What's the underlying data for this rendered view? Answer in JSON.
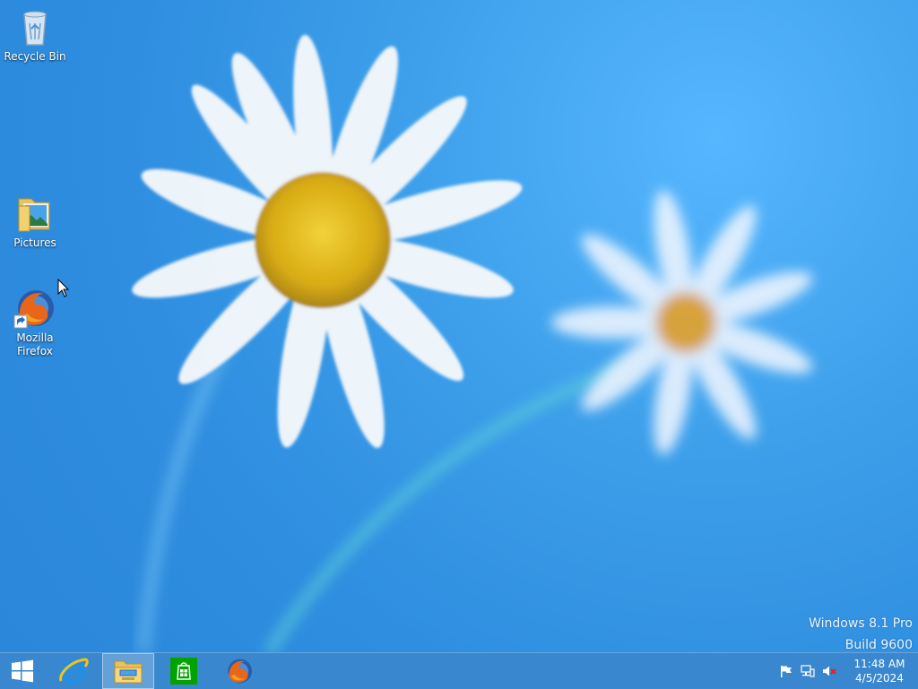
{
  "desktop": {
    "icons": [
      {
        "label": "Recycle Bin",
        "icon": "recycle-bin-icon"
      },
      {
        "label": "Pictures",
        "icon": "pictures-folder-icon"
      },
      {
        "label": "Mozilla Firefox",
        "icon": "firefox-shortcut-icon"
      }
    ],
    "watermark": {
      "line1": "Windows 8.1 Pro",
      "line2": "Build 9600"
    }
  },
  "taskbar": {
    "items": [
      {
        "name": "start",
        "icon": "windows-logo-icon"
      },
      {
        "name": "internet-explorer",
        "icon": "internet-explorer-icon"
      },
      {
        "name": "file-explorer",
        "icon": "file-explorer-icon",
        "active": true
      },
      {
        "name": "store",
        "icon": "store-icon"
      },
      {
        "name": "firefox",
        "icon": "firefox-icon"
      }
    ],
    "tray": {
      "icons": [
        "action-center-flag-icon",
        "network-icon",
        "volume-muted-icon"
      ],
      "time": "11:48 AM",
      "date": "4/5/2024"
    }
  },
  "colors": {
    "background": "#3d9fea",
    "taskbar": "#3a87cd",
    "store_green": "#00a300"
  }
}
